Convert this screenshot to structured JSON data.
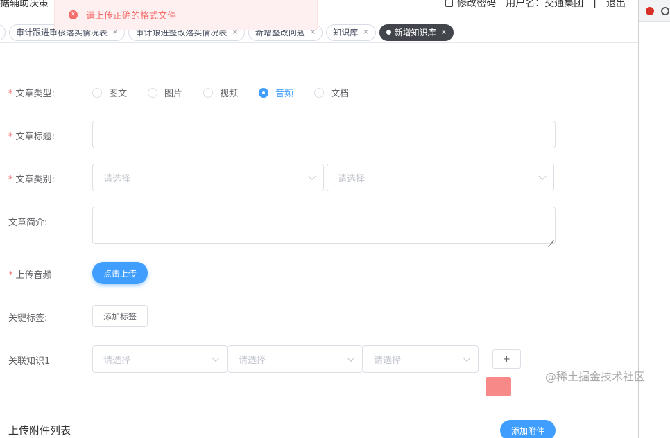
{
  "header": {
    "app_title": "据辅助决策",
    "change_password": "修改密码",
    "username_label": "用户名：交通集团",
    "divider": "|",
    "logout": "退出"
  },
  "toast": {
    "message": "请上传正确的格式文件",
    "icon": "error-circle-icon",
    "icon_glyph": "✕"
  },
  "tabs": [
    {
      "label": ""
    },
    {
      "label": "审计跟进审核落实情况表",
      "close": "×"
    },
    {
      "label": "审计跟进整改落实情况表",
      "close": "×"
    },
    {
      "label": "新增整改问题",
      "close": "×"
    },
    {
      "label": "知识库",
      "close": "×"
    },
    {
      "label": "新增知识库",
      "close": "×",
      "active": true
    }
  ],
  "form": {
    "article_type": {
      "required_mark": "*",
      "label": "文章类型:",
      "options": [
        "图文",
        "图片",
        "视频",
        "音频",
        "文档"
      ],
      "selected": "音频"
    },
    "article_title": {
      "required_mark": "*",
      "label": "文章标题:",
      "value": ""
    },
    "article_category": {
      "required_mark": "*",
      "label": "文章类别:",
      "placeholder_1": "请选择",
      "placeholder_2": "请选择"
    },
    "article_summary": {
      "label": "文章简介:",
      "value": ""
    },
    "upload_audio": {
      "required_mark": "*",
      "label": "上传音频",
      "button": "点击上传"
    },
    "keyword_tags": {
      "label": "关键标签:",
      "button": "添加标签"
    },
    "related_knowledge": {
      "label": "关联知识1",
      "placeholder_1": "请选择",
      "placeholder_2": "请选择",
      "placeholder_3": "请选择",
      "add_button": "+",
      "remove_button": "-"
    },
    "attachments": {
      "title": "上传附件列表",
      "add_button": "添加附件"
    }
  },
  "watermark": "@稀土掘金技术社区",
  "colors": {
    "primary": "#409eff",
    "danger": "#f56c6c",
    "danger_light": "#f78989",
    "active_tab": "#42464c"
  }
}
